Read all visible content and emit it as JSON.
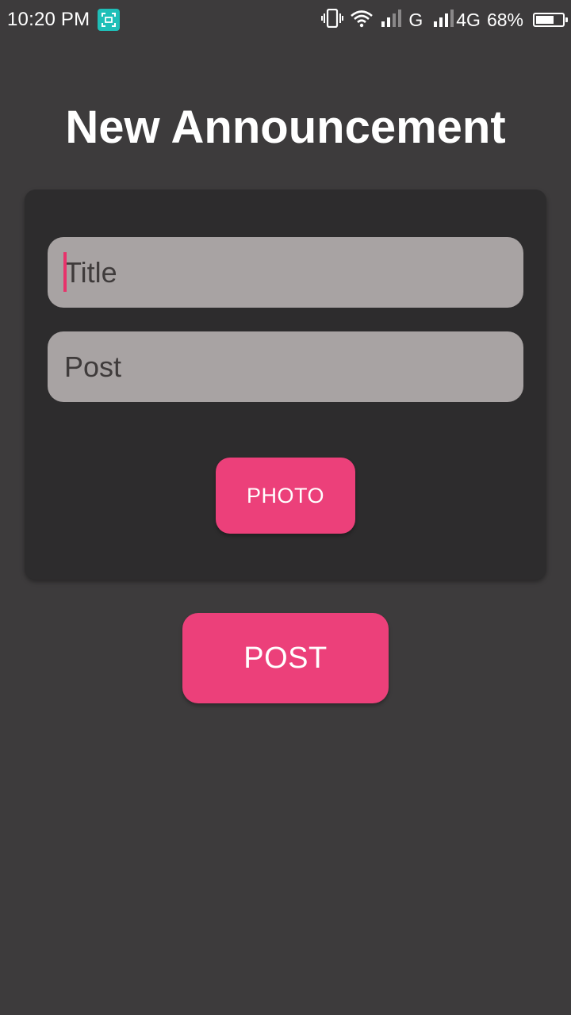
{
  "status_bar": {
    "time": "10:20 PM",
    "network_g": "G",
    "network_4g": "4G",
    "battery_percent": "68%",
    "battery_level": 0.68,
    "icons": [
      "screen-capture-icon",
      "vibrate-icon",
      "wifi-icon",
      "signal-icon",
      "signal-icon",
      "battery-icon"
    ]
  },
  "page": {
    "title": "New Announcement"
  },
  "form": {
    "title_placeholder": "Title",
    "post_placeholder": "Post",
    "photo_label": "PHOTO"
  },
  "actions": {
    "post_label": "POST"
  },
  "colors": {
    "background": "#3d3b3c",
    "card": "#2d2c2d",
    "field": "#a8a3a3",
    "accent": "#ec407a",
    "screen_capture_badge": "#1fbfb8"
  }
}
